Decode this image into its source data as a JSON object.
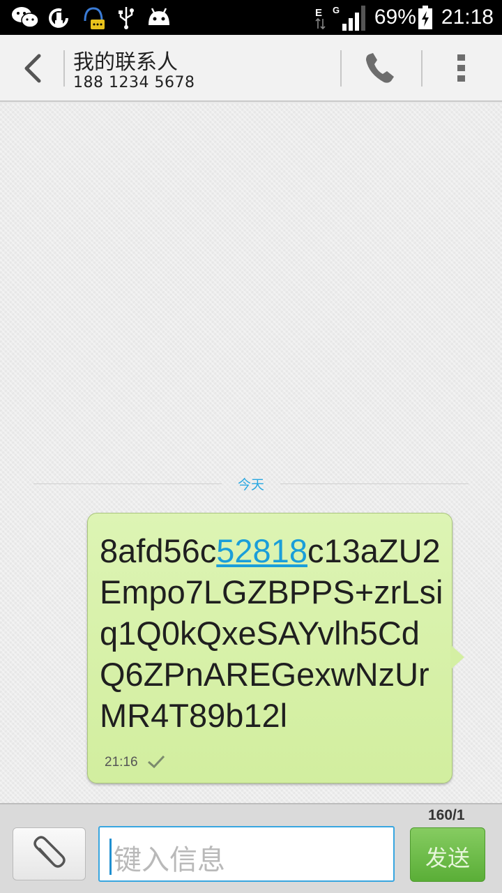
{
  "status_bar": {
    "icons": [
      "wechat-icon",
      "clean-master-icon",
      "qq-icon",
      "usb-icon",
      "android-icon",
      "data-arrows-icon",
      "network-type-icon",
      "signal-icon",
      "battery-charging-icon"
    ],
    "network_type": "G",
    "data_type": "E",
    "battery_percent": "69%",
    "time": "21:18"
  },
  "header": {
    "contact_name": "我的联系人",
    "contact_phone": "188 1234 5678",
    "icons": {
      "back": "chevron-left-icon",
      "call": "phone-icon",
      "menu": "overflow-menu-icon"
    }
  },
  "conversation": {
    "date_separator": "今天",
    "messages": [
      {
        "direction": "sent",
        "text_before_link": "8afd56c",
        "link_text": "52818",
        "text_after_link": "c13aZU2Empo7LGZBPPS+zrLsiq1Q0kQxeSAYvlh5CdQ6ZPnAREGexwNzUrMR4T89b12l",
        "time": "21:16",
        "status": "sent-check-icon"
      }
    ]
  },
  "compose": {
    "char_counter": "160/1",
    "placeholder": "键入信息",
    "send_label": "发送",
    "attach_icon": "paperclip-icon"
  },
  "colors": {
    "accent": "#29a7e1",
    "bubble": "#d6f0a8",
    "send_button": "#6cbd49"
  }
}
